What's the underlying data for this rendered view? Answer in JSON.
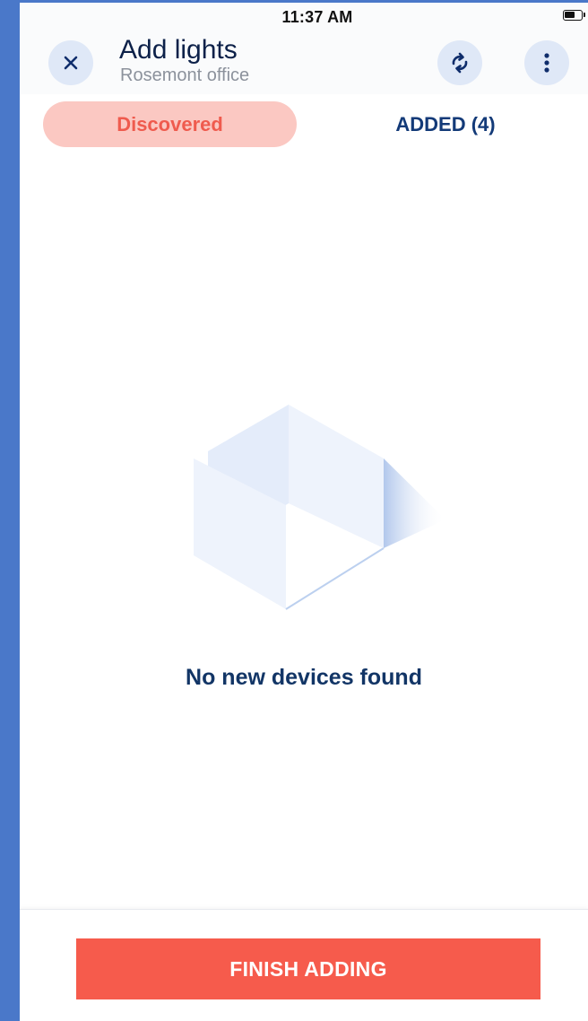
{
  "status_bar": {
    "time": "11:37 AM",
    "battery_icon": "battery-icon"
  },
  "header": {
    "title": "Add lights",
    "subtitle": "Rosemont office",
    "close_icon": "close-icon",
    "sync_icon": "sync-icon",
    "more_icon": "more-vertical-icon"
  },
  "tabs": [
    {
      "label": "Discovered",
      "selected": true
    },
    {
      "label": "ADDED (4)",
      "selected": false
    }
  ],
  "empty_state": {
    "illustration": "empty-box-illustration",
    "message": "No new devices found"
  },
  "footer": {
    "finish_label": "FINISH ADDING"
  },
  "colors": {
    "accent": "#f65b4c",
    "tab_selected_bg": "#fbc8c2",
    "navy": "#0d2149",
    "icon_button_bg": "#dfe8f7"
  }
}
